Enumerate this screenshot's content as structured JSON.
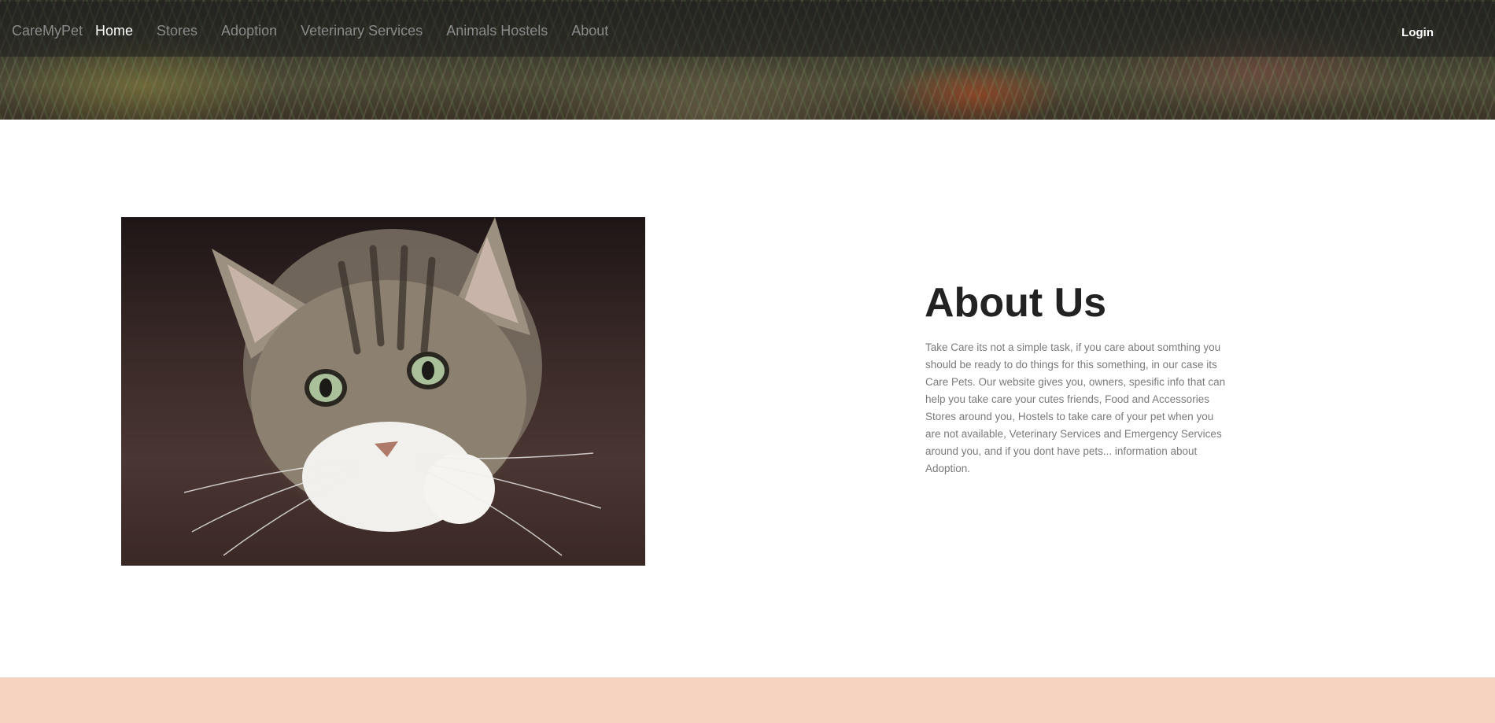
{
  "nav": {
    "brand": "CareMyPet",
    "links": [
      "Home",
      "Stores",
      "Adoption",
      "Veterinary Services",
      "Animals Hostels",
      "About"
    ],
    "active": "Home",
    "login": "Login"
  },
  "about": {
    "title": "About Us",
    "text": "Take Care its not a simple task, if you care about somthing you should be ready to do things for this something, in our case its Care Pets. Our website gives you, owners, spesific info that can help you take care your cutes friends, Food and Accessories Stores around you, Hostels to take care of your pet when you are not available, Veterinary Services and Emergency Services around you, and if you dont have pets... information about Adoption."
  },
  "colors": {
    "footer_band": "#f6d3c0",
    "nav_active": "#ffffff",
    "nav_inactive": "#8a8a8a",
    "heading": "#222222",
    "body_text": "#7a7a7a"
  }
}
